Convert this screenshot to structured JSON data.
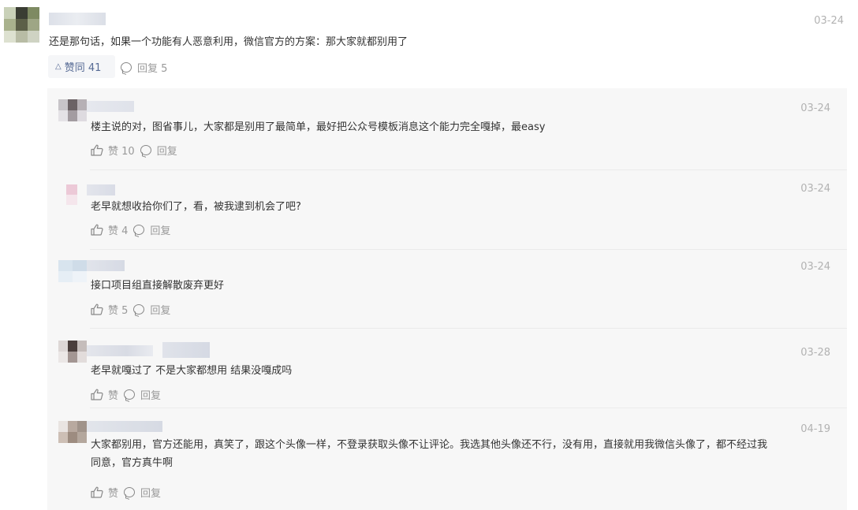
{
  "top_comment": {
    "date": "03-24",
    "text": "还是那句话，如果一个功能有人恶意利用，微信官方的方案：那大家就都别用了",
    "like_label": "赞同 41",
    "reply_label": "回复 5"
  },
  "replies": [
    {
      "date": "03-24",
      "text": "楼主说的对，图省事儿，大家都是别用了最简单，最好把公众号模板消息这个能力完全嘎掉，最easy",
      "like_label": "赞 10",
      "reply_label": "回复"
    },
    {
      "date": "03-24",
      "text": "老早就想收拾你们了，看，被我逮到机会了吧?",
      "like_label": "赞 4",
      "reply_label": "回复"
    },
    {
      "date": "03-24",
      "text": "接口项目组直接解散废弃更好",
      "like_label": "赞 5",
      "reply_label": "回复"
    },
    {
      "date": "03-28",
      "text": "老早就嘎过了 不是大家都想用 结果没嘎成吗",
      "like_label": "赞",
      "reply_label": "回复"
    },
    {
      "date": "04-19",
      "text_line1": "大家都别用，官方还能用，真笑了，跟这个头像一样，不登录获取头像不让评论。我选其他头像还不行，没有用，直接就用我微信头像了，都不经过我",
      "text_line2": "同意，官方真牛啊",
      "like_label": "赞",
      "reply_label": "回复"
    }
  ]
}
